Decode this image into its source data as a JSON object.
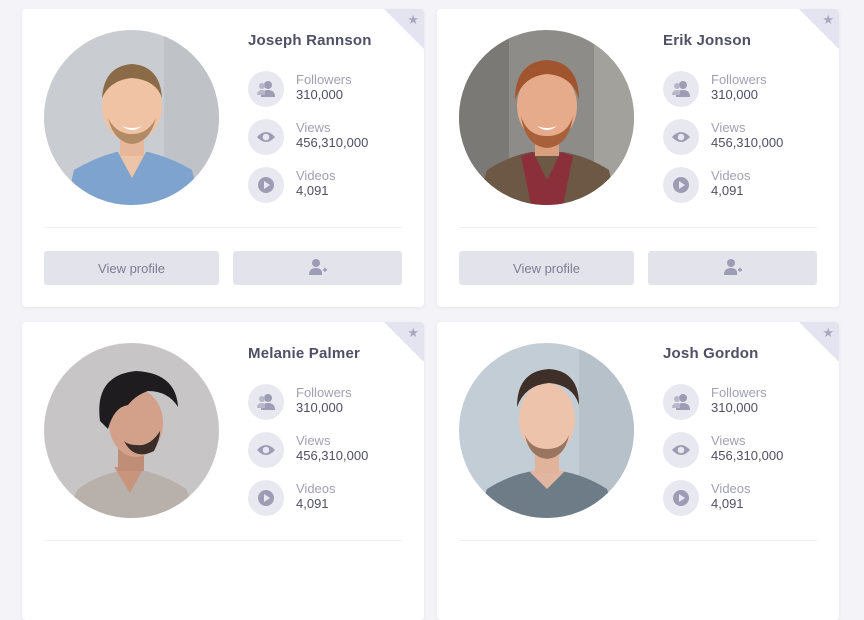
{
  "colors": {
    "page_background": "#f3f3f8",
    "card_background": "#ffffff",
    "icon_background": "#e8e8f0",
    "icon_color": "#9c9cb4",
    "button_background": "#e3e3ec",
    "name_color": "#4f4f65",
    "label_color": "#a0a0b4"
  },
  "icons": {
    "followers": "users-icon",
    "views": "eye-icon",
    "videos": "play-icon",
    "add_user": "add-user-icon",
    "favorite": "star-icon"
  },
  "stat_labels": {
    "followers": "Followers",
    "views": "Views",
    "videos": "Videos"
  },
  "buttons": {
    "view_profile": "View profile"
  },
  "cards": [
    {
      "name": "Joseph Rannson",
      "followers": "310,000",
      "views": "456,310,000",
      "videos": "4,091"
    },
    {
      "name": "Erik Jonson",
      "followers": "310,000",
      "views": "456,310,000",
      "videos": "4,091"
    },
    {
      "name": "Melanie Palmer",
      "followers": "310,000",
      "views": "456,310,000",
      "videos": "4,091"
    },
    {
      "name": "Josh Gordon",
      "followers": "310,000",
      "views": "456,310,000",
      "videos": "4,091"
    }
  ]
}
